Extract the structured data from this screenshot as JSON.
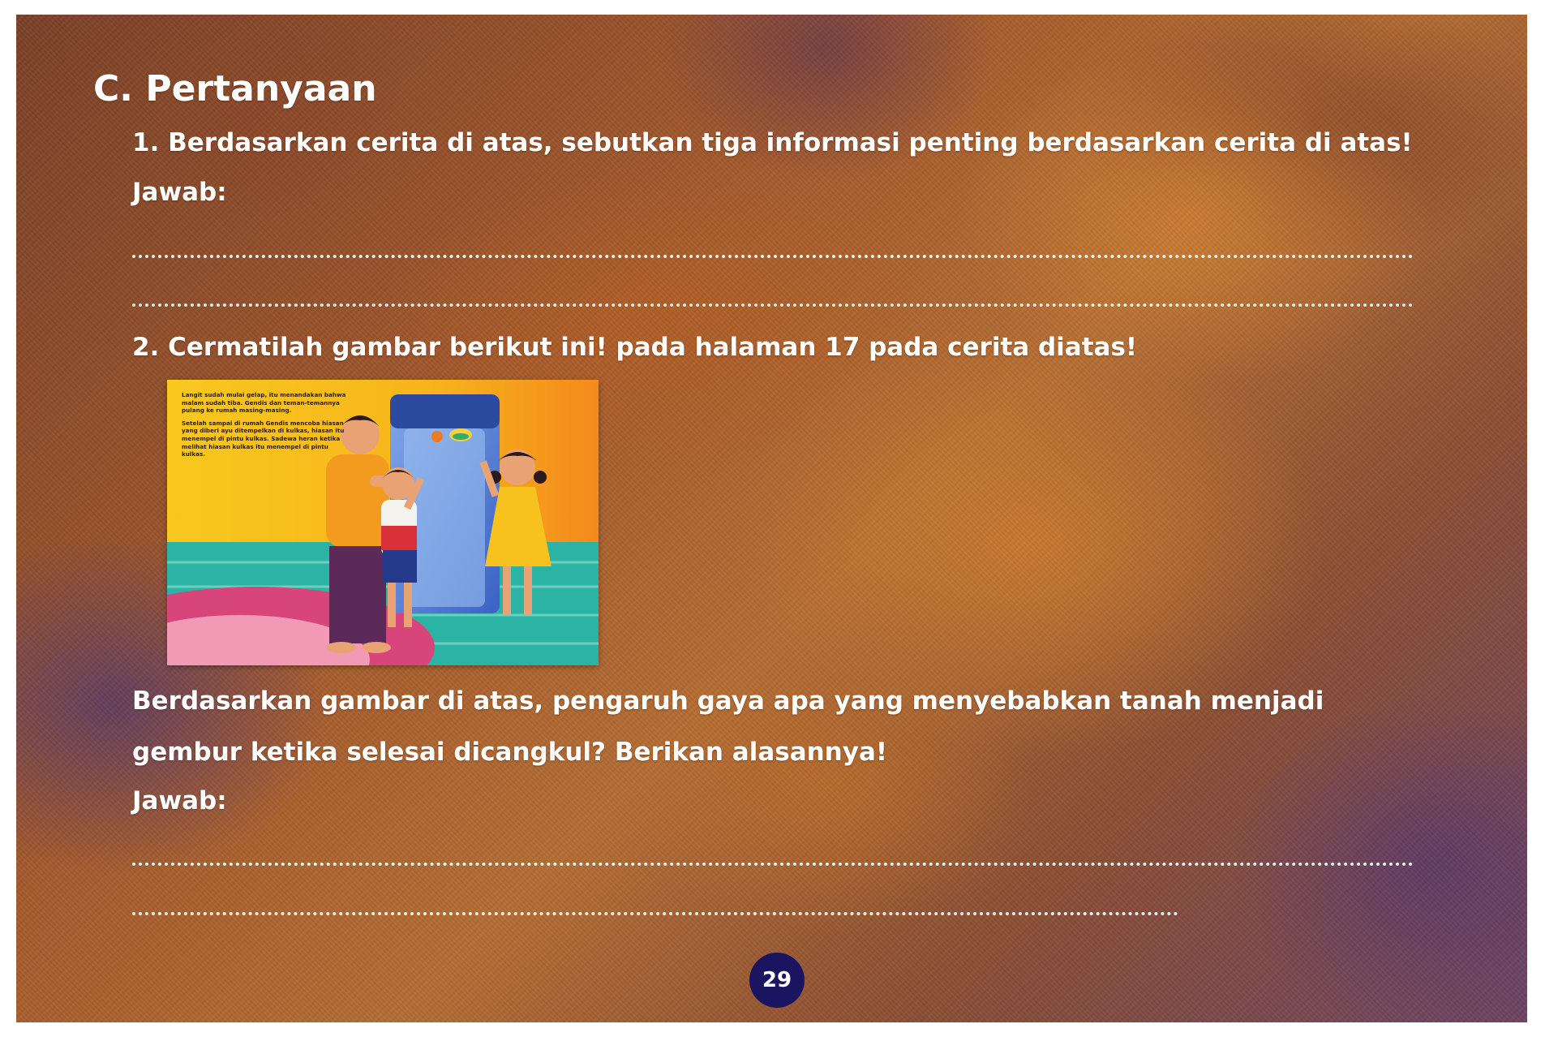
{
  "section": {
    "title": "C.  Pertanyaan"
  },
  "question1": {
    "text": "1. Berdasarkan cerita di atas, sebutkan tiga informasi penting berdasarkan cerita di atas!",
    "answer_label": "Jawab:"
  },
  "question2": {
    "text": "2. Cermatilah gambar berikut ini! pada halaman 17 pada cerita diatas!",
    "body_line1": "Berdasarkan gambar di atas, pengaruh gaya apa yang menyebabkan tanah menjadi",
    "body_line2": "gembur ketika selesai dicangkul? Berikan alasannya!",
    "answer_label": "Jawab:"
  },
  "illustration": {
    "paragraph1": "Langit sudah mulai gelap, itu menandakan bahwa malam sudah tiba. Gendis dan teman-temannya pulang ke rumah masing-masing.",
    "paragraph2": "Setelah sampai di rumah Gendis mencoba hiasan yang diberi ayu ditempelkan di kulkas, hiasan itu menempel di pintu kulkas. Sadewa heran ketika melihat hiasan kulkas itu menempel di pintu kulkas."
  },
  "page_number": "29",
  "colors": {
    "text": "#ffffff",
    "badge": "#1b1460"
  }
}
